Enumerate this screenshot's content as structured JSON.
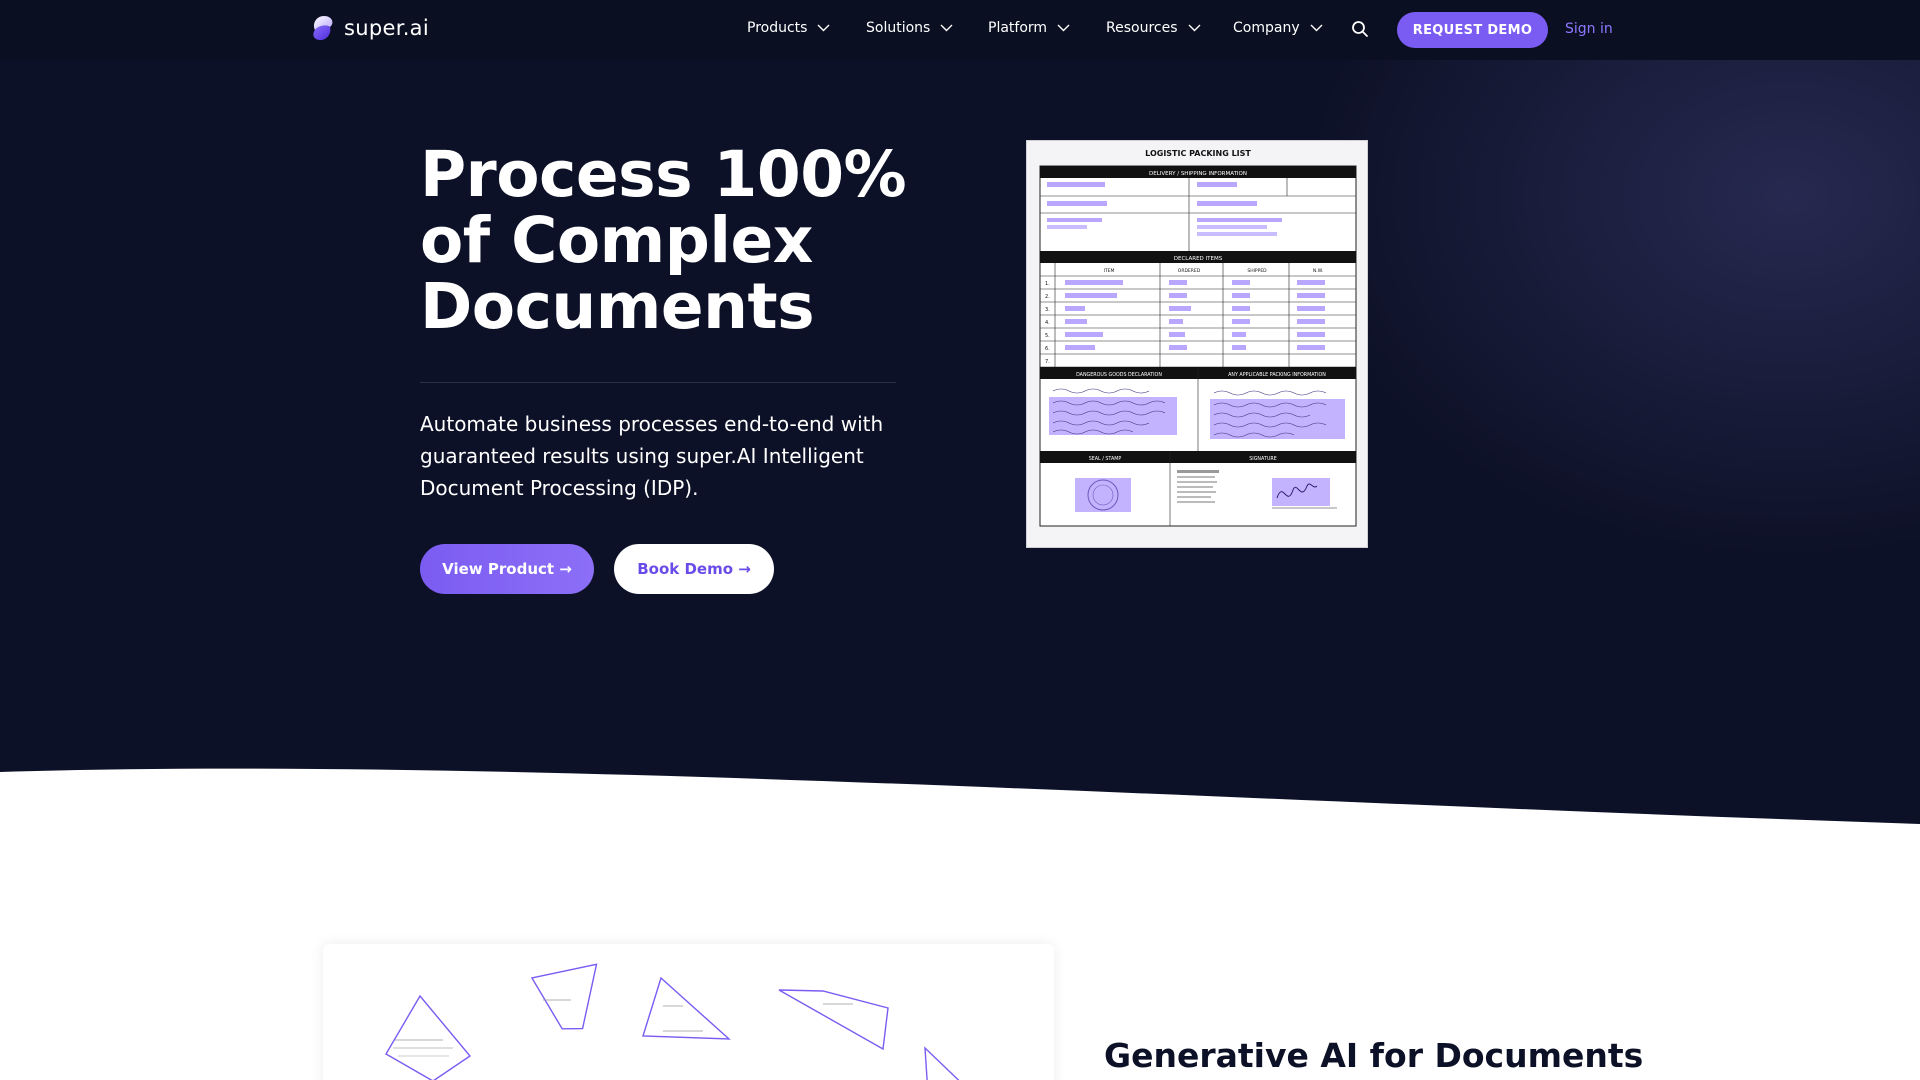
{
  "brand": {
    "name": "super.ai",
    "logo_icon": "super-ai-logo-icon"
  },
  "nav": {
    "items": [
      {
        "label": "Products"
      },
      {
        "label": "Solutions"
      },
      {
        "label": "Platform"
      },
      {
        "label": "Resources"
      },
      {
        "label": "Company"
      }
    ],
    "search_icon": "search-icon",
    "request_demo": "REQUEST DEMO",
    "sign_in": "Sign in"
  },
  "hero": {
    "title": "Process 100% of Complex Documents",
    "subtitle": "Automate business processes end-to-end with guaranteed results using super.AI Intelligent Document Processing (IDP).",
    "primary_button": "View Product →",
    "secondary_button": "Book Demo →"
  },
  "document": {
    "title": "LOGISTIC PACKING LIST",
    "section_shipping": "DELIVERY / SHIPPING INFORMATION",
    "section_items": "DECLARED ITEMS",
    "items_headers": [
      "ITEM",
      "ORDERED",
      "SHIPPED",
      "N.W."
    ],
    "row_numbers": [
      "1.",
      "2.",
      "3.",
      "4.",
      "5.",
      "6.",
      "7."
    ],
    "section_dangerous": "DANGEROUS GOODS DECLARATION",
    "section_packing": "ANY APPLICABLE PACKING INFORMATION",
    "section_seal": "SEAL / STAMP",
    "section_signature": "SIGNATURE"
  },
  "lower": {
    "section_title": "Generative AI for Documents"
  },
  "colors": {
    "hero_bg": "#0d1127",
    "accent": "#7b5cf2",
    "highlight": "#b9a6ff"
  }
}
